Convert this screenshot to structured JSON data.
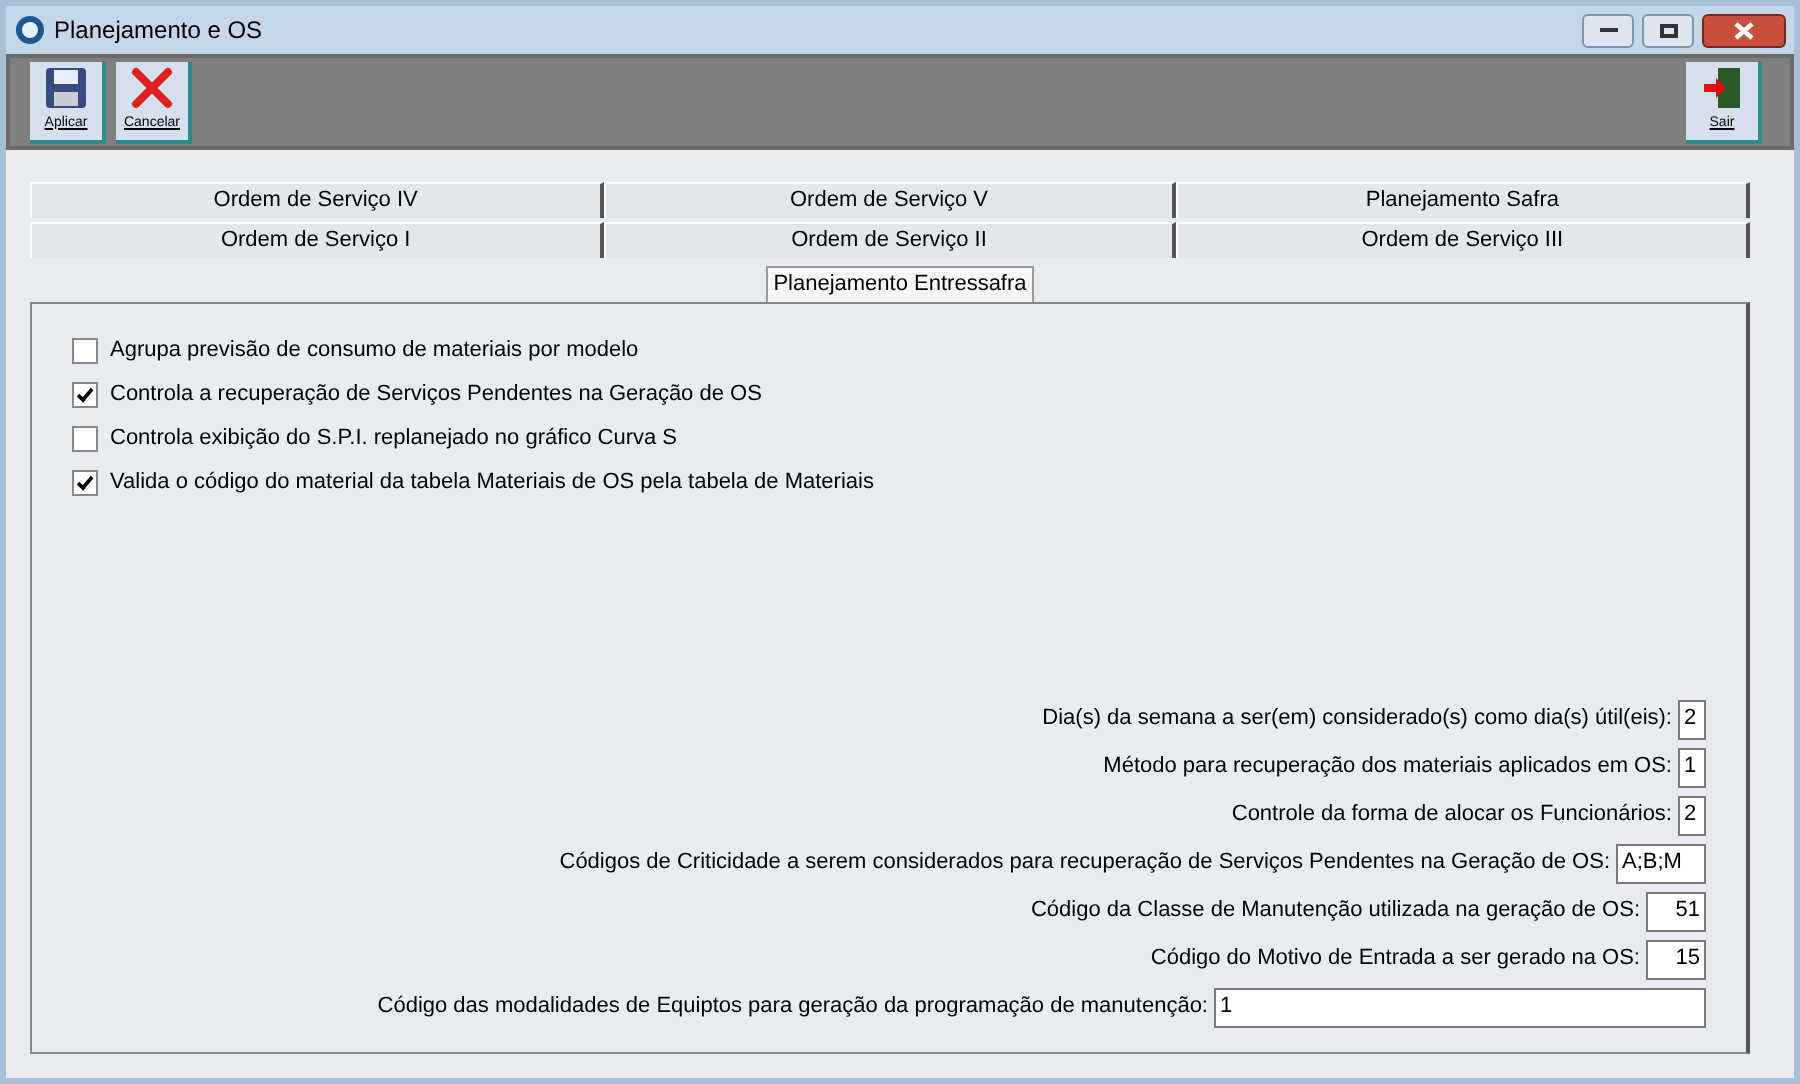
{
  "window": {
    "title": "Planejamento e OS"
  },
  "toolbar": [
    {
      "kind": "save",
      "label": "Aplicar"
    },
    {
      "kind": "cancel",
      "label": "Cancelar"
    }
  ],
  "exit_button": {
    "label": "Sair"
  },
  "tab_rows": [
    [
      {
        "label": "Ordem de Serviço IV",
        "selected": false
      },
      {
        "label": "Ordem de Serviço V",
        "selected": false
      },
      {
        "label": "Planejamento Safra",
        "selected": false
      }
    ],
    [
      {
        "label": "Ordem de Serviço I",
        "selected": false
      },
      {
        "label": "Ordem de Serviço II",
        "selected": false
      },
      {
        "label": "Ordem de Serviço III",
        "selected": false
      }
    ],
    [
      {
        "label": "Planejamento Entressafra",
        "selected": true
      }
    ]
  ],
  "options": [
    {
      "label": "Agrupa previsão de consumo de materiais por modelo",
      "checked": false
    },
    {
      "label": "Controla a recuperação de Serviços Pendentes na Geração de OS",
      "checked": true
    },
    {
      "label": "Controla exibição do S.P.I. replanejado no gráfico Curva S",
      "checked": false
    },
    {
      "label": "Valida o código do material da tabela Materiais de OS pela tabela de Materiais",
      "checked": true
    }
  ],
  "fields": [
    {
      "label": "Dia(s) da semana a ser(em) considerado(s) como dia(s) útil(eis):",
      "value": "2",
      "kind": "digit"
    },
    {
      "label": "Método para recuperação dos materiais aplicados em OS:",
      "value": "1",
      "kind": "digit"
    },
    {
      "label": "Controle da forma de alocar os Funcionários:",
      "value": "2",
      "kind": "digit"
    },
    {
      "label": "Códigos de Criticidade a serem considerados para recuperação de Serviços Pendentes na Geração de OS:",
      "value": "A;B;M",
      "kind": "codes"
    },
    {
      "label": "Código da Classe de Manutenção utilizada na geração de OS:",
      "value": "51",
      "kind": "number"
    },
    {
      "label": "Código do Motivo de Entrada a ser gerado na OS:",
      "value": "15",
      "kind": "number"
    },
    {
      "label": "Código das modalidades de Equiptos para geração da programação de manutenção:",
      "value": "1",
      "kind": "text"
    }
  ]
}
